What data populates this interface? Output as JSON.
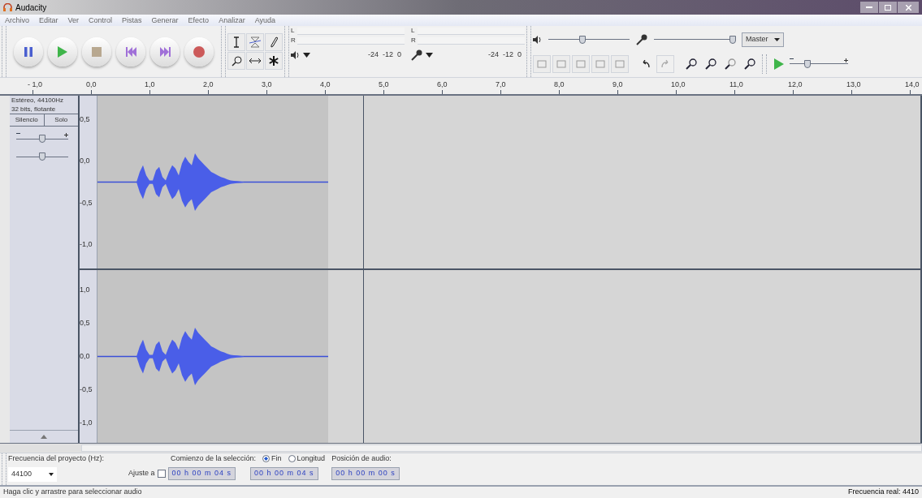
{
  "window": {
    "title": "Audacity"
  },
  "menu": [
    "Archivo",
    "Editar",
    "Ver",
    "Control",
    "Pistas",
    "Generar",
    "Efecto",
    "Analizar",
    "Ayuda"
  ],
  "meters": {
    "playback_channels": [
      "L",
      "R"
    ],
    "playback_scale": [
      "-24",
      "-12",
      "0"
    ],
    "record_channels": [
      "L",
      "R"
    ],
    "record_scale": [
      "-24",
      "-12",
      "0"
    ]
  },
  "mixer": {
    "playback_volume": {
      "level": 0.42
    },
    "record_volume": {
      "level": 0.97
    },
    "source": "Master"
  },
  "play_at_speed": {
    "level": 0.3
  },
  "ruler": [
    "- 1,0",
    "0,0",
    "1,0",
    "2,0",
    "3,0",
    "4,0",
    "5,0",
    "6,0",
    "7,0",
    "8,0",
    "9,0",
    "10,0",
    "11,0",
    "12,0",
    "13,0",
    "14,0"
  ],
  "track": {
    "info": [
      "Estéreo, 44100Hz",
      "32 bits, flotante"
    ],
    "mute": "Silencio",
    "solo": "Solo",
    "gain": {
      "level": 0.5
    },
    "pan": {
      "level": 0.5
    },
    "channels": [
      {
        "scale": [
          "0,5",
          "0,0",
          "-0,5",
          "-1,0"
        ]
      },
      {
        "scale": [
          "1,0",
          "0,5",
          "0,0",
          "-0,5",
          "-1,0"
        ]
      }
    ]
  },
  "selection_bar": {
    "rate_label": "Frecuencia del proyecto (Hz):",
    "rate": "44100",
    "snap_label": "Ajuste a",
    "snap": false,
    "start_label": "Comienzo de la selección:",
    "end_modes": [
      {
        "label": "Fin",
        "selected": true
      },
      {
        "label": "Longitud",
        "selected": false
      }
    ],
    "start": "00 h 00 m 04 s",
    "end": "00 h 00 m 04 s",
    "position_label": "Posición de audio:",
    "position": "00 h 00 m 00 s"
  },
  "status_bar": {
    "hint": "Haga clic y arrastre para seleccionar audio",
    "rate": "Frecuencia real: 4410"
  }
}
